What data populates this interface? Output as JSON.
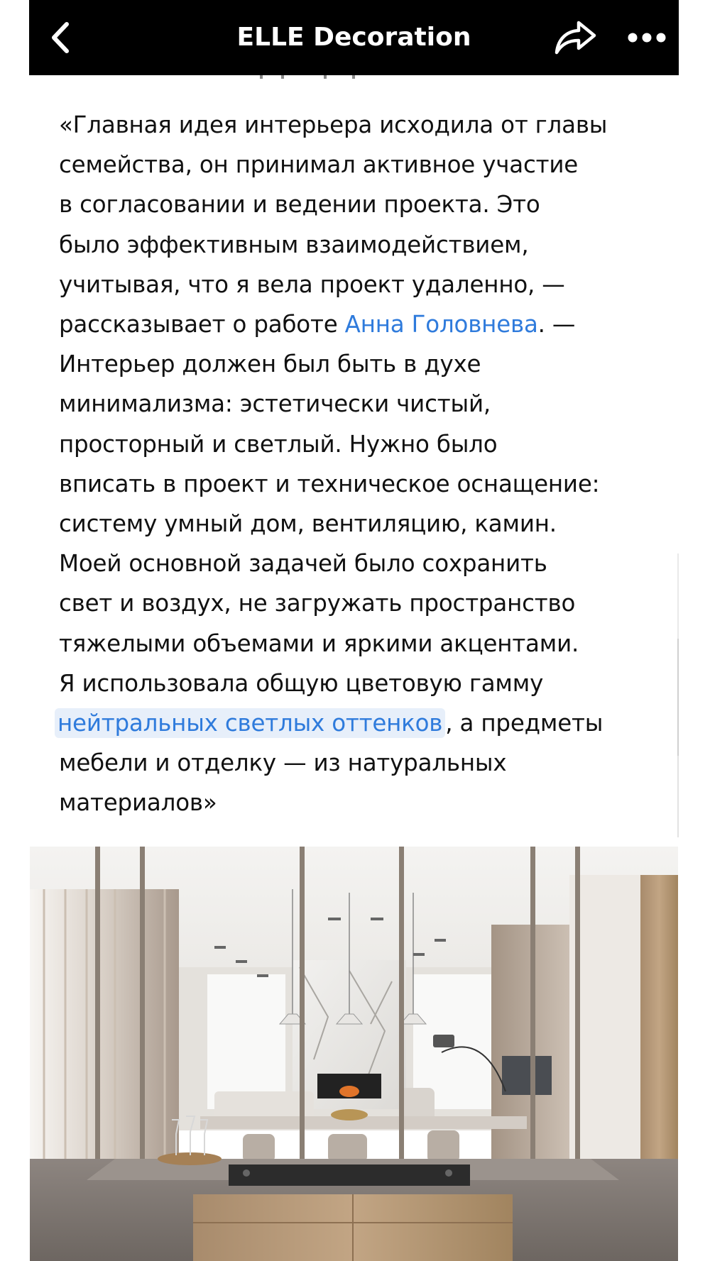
{
  "topbar": {
    "title": "ELLE Decoration",
    "back_icon": "chevron-left-icon",
    "share_icon": "share-arrow-icon",
    "more_icon": "more-dots-icon"
  },
  "article": {
    "quote_part1": "«Главная идея интерьера исходила от главы\nсемейства, он принимал активное участие\nв согласовании и ведении проекта. Это\nбыло эффективным взаимодействием,\nучитывая, что я вела проект удаленно, —\nрассказывает о работе ",
    "designer_link": "Анна Головнева",
    "quote_part2": ". —\nИнтерьер должен был быть в духе\nминимализма: эстетически чистый,\nпросторный и светлый. Нужно было\nвписать в проект и техническое оснащение:\nсистему умный дом, вентиляцию, камин.\nМоей основной задачей было сохранить\nсвет и воздух, не загружать пространство\nтяжелыми объемами и яркими акцентами.\nЯ использовала общую цветовую гамму\n",
    "palette_link": "нейтральных светлых оттенков",
    "quote_part3": ", а предметы\nмебели и отделку — из натуральных\nматериалов»"
  },
  "colors": {
    "link": "#2f7bdc",
    "link_highlight": "#e7effa",
    "topbar_bg": "#000000",
    "text": "#111111"
  }
}
